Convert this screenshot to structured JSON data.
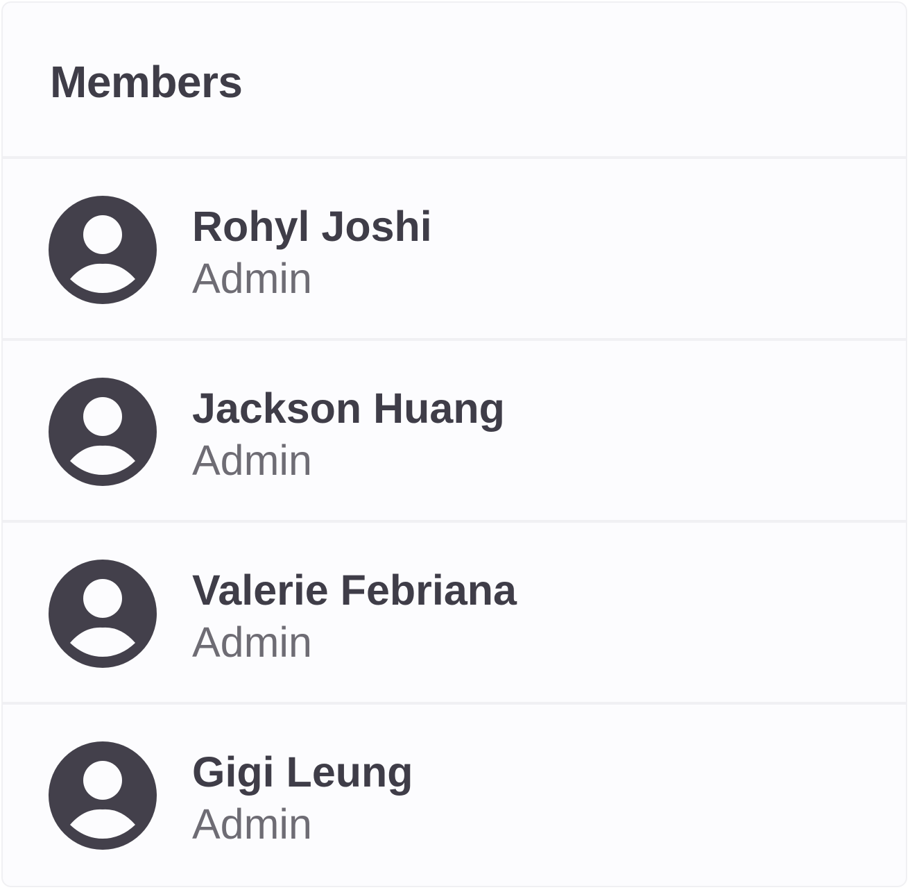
{
  "header": {
    "title": "Members"
  },
  "members": [
    {
      "name": "Rohyl Joshi",
      "role": "Admin",
      "avatar_icon": "user-avatar-icon"
    },
    {
      "name": "Jackson Huang",
      "role": "Admin",
      "avatar_icon": "user-avatar-icon"
    },
    {
      "name": "Valerie Febriana",
      "role": "Admin",
      "avatar_icon": "user-avatar-icon"
    },
    {
      "name": "Gigi Leung",
      "role": "Admin",
      "avatar_icon": "user-avatar-icon"
    }
  ],
  "colors": {
    "text_primary": "#3f3d48",
    "text_secondary": "#6e6c74",
    "divider": "#f0f0f3",
    "panel_background": "#fcfcfe",
    "avatar_fill": "#43404b"
  }
}
